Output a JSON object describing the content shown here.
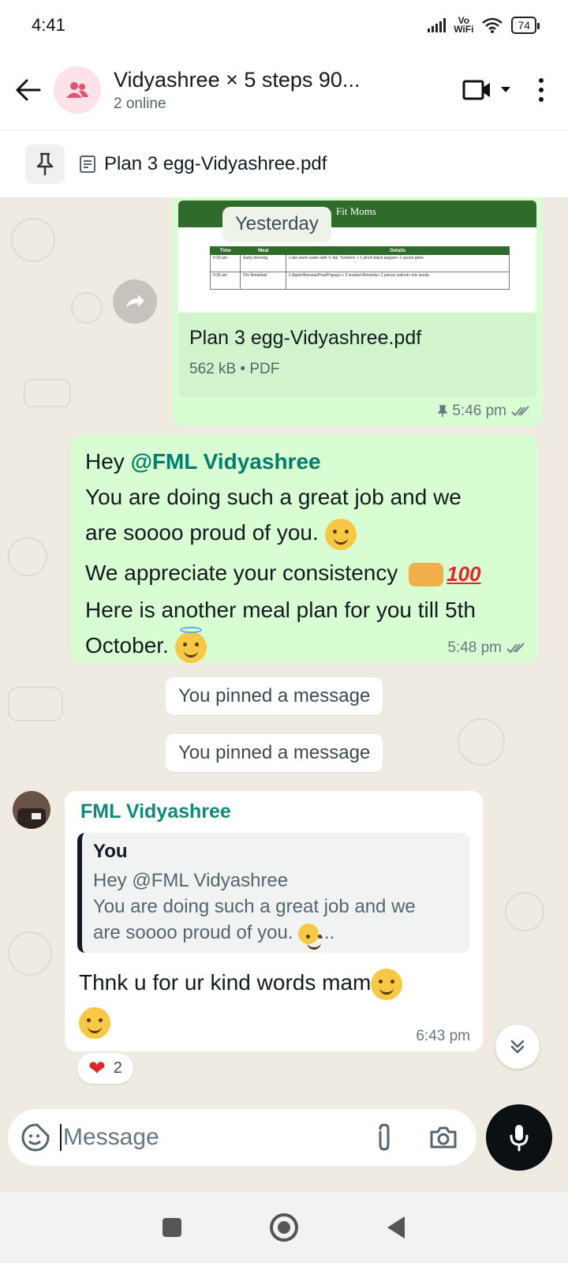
{
  "status_bar": {
    "time": "4:41",
    "network_label_top": "Vo",
    "network_label_bottom": "WiFi",
    "battery": "74"
  },
  "header": {
    "title": "Vidyashree × 5 steps 90...",
    "subtitle": "2 online",
    "avatar_color": "#fde2ea",
    "avatar_icon_color": "#e0547a"
  },
  "pinned": {
    "label": "Plan 3 egg-Vidyashree.pdf"
  },
  "date_chip": "Yesterday",
  "pdf_message": {
    "preview": {
      "logo_text": "Fit Moms",
      "columns": [
        "Time",
        "Meal",
        "Details"
      ],
      "rows": [
        [
          "6:30 am",
          "Early morning",
          "Luke warm water with ½ tsp. Turmeric + 1 pinch black pepper+ 1 spoon ghee"
        ],
        [
          "9:30 am",
          "Pre Breakfast",
          "1 Apple/Banana/Pear/Papaya + 5 soaked Almonds+ 2 pieces walnut+ mix seeds"
        ]
      ]
    },
    "file_name": "Plan 3 egg-Vidyashree.pdf",
    "file_meta": "562 kB • PDF",
    "time": "5:46 pm"
  },
  "text_message": {
    "greeting": "Hey ",
    "mention": "@FML Vidyashree",
    "line1": "You are doing such a great job and we",
    "line2": "are soooo proud of you. ",
    "line3": "We appreciate your consistency ",
    "line4": "Here is another meal plan for you till 5th",
    "line5": "October. ",
    "time": "5:48 pm"
  },
  "system_messages": [
    "You pinned a message",
    "You pinned a message"
  ],
  "reply_message": {
    "sender": "FML Vidyashree",
    "quote_title": "You",
    "quote_line1": "Hey @FML Vidyashree",
    "quote_line2": "You are doing such a great job and we",
    "quote_line3": "are soooo proud of you. ",
    "quote_ellipsis": "...",
    "text": "Thnk u for ur kind words mam",
    "time": "6:43 pm"
  },
  "reaction": {
    "count": "2"
  },
  "composer": {
    "placeholder": "Message"
  },
  "colors": {
    "outgoing_bubble": "#d9fdd3",
    "mention": "#027e6d",
    "sender_name": "#0f8a7a",
    "chat_background": "#efeae2"
  }
}
